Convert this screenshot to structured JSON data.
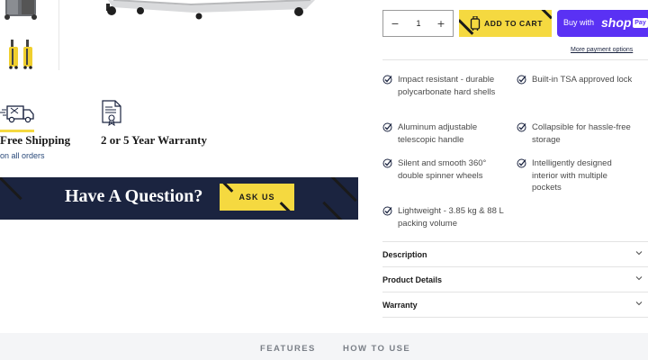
{
  "benefits": {
    "shipping": {
      "title": "Free Shipping",
      "subtitle": "on all orders",
      "icon": "delivery-truck-icon"
    },
    "warranty": {
      "title": "2 or 5 Year Warranty",
      "icon": "certificate-icon"
    }
  },
  "question_banner": {
    "text": "Have A Question?",
    "button_label": "ASK US"
  },
  "purchase": {
    "quantity": {
      "minus": "−",
      "value": "1",
      "plus": "+"
    },
    "add_to_cart": "ADD TO CART",
    "shop_pay": {
      "prefix": "Buy with",
      "logo": "shop",
      "badge": "Pay"
    },
    "more_payment": "More payment options"
  },
  "features": [
    "Impact resistant - durable polycarbonate hard shells",
    "Built-in TSA approved lock",
    "Aluminum adjustable telescopic handle",
    "Collapsible for hassle-free storage",
    "Silent and smooth 360° double spinner wheels",
    "Intelligently designed interior with multiple pockets",
    "Lightweight - 3.85 kg & 88 L packing volume"
  ],
  "accordion": [
    {
      "label": "Description"
    },
    {
      "label": "Product Details"
    },
    {
      "label": "Warranty"
    }
  ],
  "tabs": {
    "features": "FEATURES",
    "how_to_use": "HOW TO USE"
  },
  "colors": {
    "accent_yellow": "#f5d940",
    "navy": "#1b2440",
    "shop_purple": "#5a31f4"
  }
}
